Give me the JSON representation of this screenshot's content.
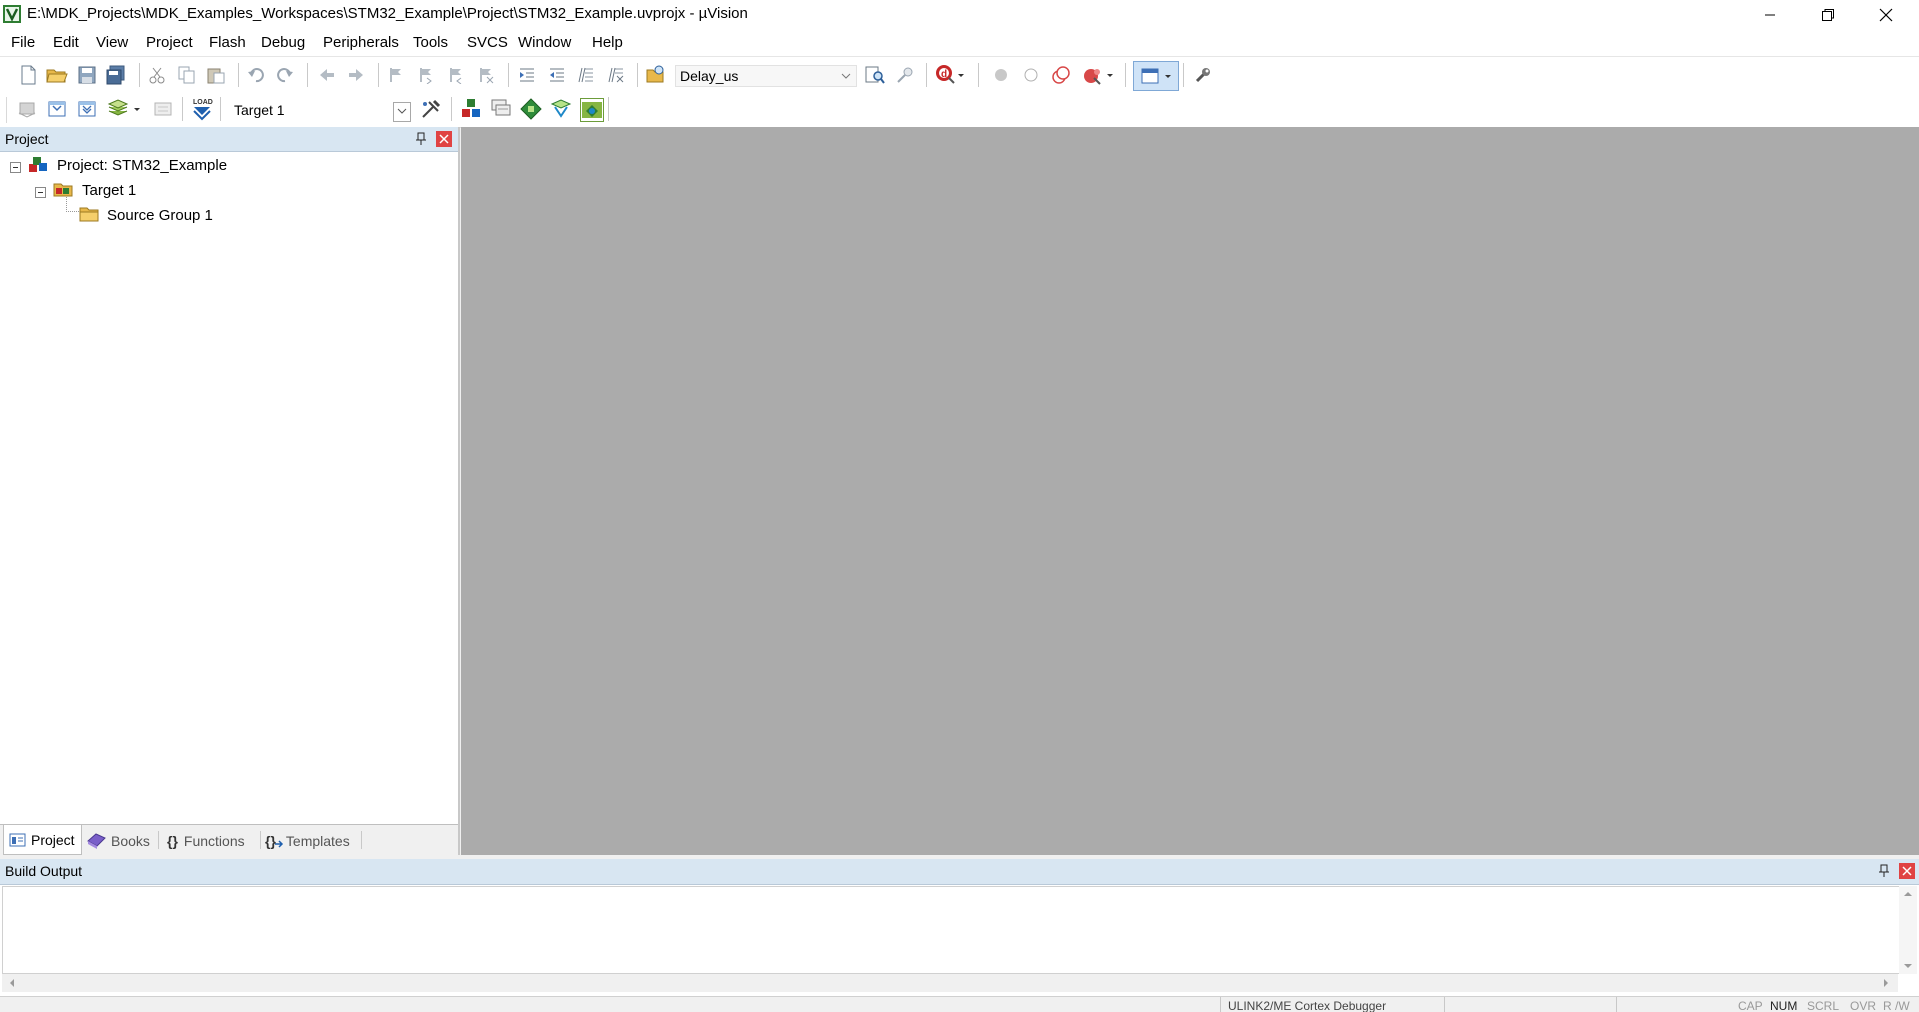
{
  "window": {
    "title": "E:\\MDK_Projects\\MDK_Examples_Workspaces\\STM32_Example\\Project\\STM32_Example.uvprojx - µVision"
  },
  "menu": [
    "File",
    "Edit",
    "View",
    "Project",
    "Flash",
    "Debug",
    "Peripherals",
    "Tools",
    "SVCS",
    "Window",
    "Help"
  ],
  "toolbar1": {
    "find_combo_value": "Delay_us"
  },
  "toolbar2": {
    "target_combo_value": "Target 1",
    "load_label": "LOAD"
  },
  "project_panel": {
    "title": "Project",
    "tree": {
      "project_label": "Project: STM32_Example",
      "target_label": "Target 1",
      "group_label": "Source Group 1"
    },
    "tabs": [
      "Project",
      "Books",
      "Functions",
      "Templates"
    ]
  },
  "build_output": {
    "title": "Build Output"
  },
  "status": {
    "debugger": "ULINK2/ME Cortex Debugger",
    "indicators": [
      "CAP",
      "NUM",
      "SCRL",
      "OVR",
      "R /W"
    ]
  },
  "colors": {
    "panel_header": "#d8e6f2",
    "editor_bg": "#ababab",
    "close_red": "#e04343"
  }
}
